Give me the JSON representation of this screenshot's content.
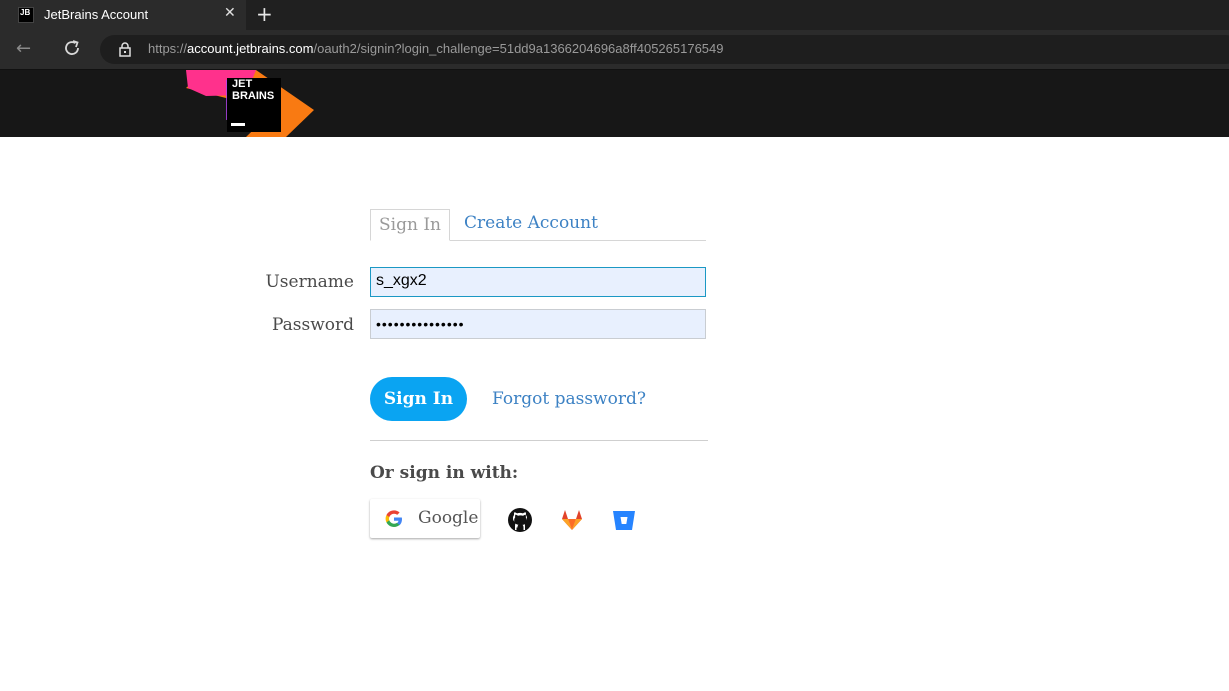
{
  "browser": {
    "tab_favicon_text": "JB",
    "tab_title": "JetBrains Account",
    "close_glyph": "✕",
    "new_tab_glyph": "+",
    "back_glyph": "←",
    "url_prefix": "https://",
    "url_host": "account.jetbrains.com",
    "url_path": "/oauth2/signin?login_challenge=51dd9a1366204696a8ff405265176549"
  },
  "header": {
    "logo_line1": "JET",
    "logo_line2": "BRAINS",
    "logo_colors": [
      "#f97a12",
      "#b345f1",
      "#ff318c",
      "#000000"
    ]
  },
  "form": {
    "tabs": {
      "signin_label": "Sign In",
      "create_label": "Create Account"
    },
    "username_label": "Username",
    "username_value": "s_xgx2",
    "password_label": "Password",
    "password_value": "•••••••••••••••",
    "signin_button": "Sign In",
    "forgot_link": "Forgot password?",
    "or_signin_with": "Or sign in with:",
    "google_label": "Google",
    "social_icons": [
      "github-icon",
      "gitlab-icon",
      "bitbucket-icon"
    ]
  },
  "colors": {
    "accent_button": "#0aa4f2",
    "link": "#3d82c4",
    "input_bg": "#e8f0fe",
    "header_bg": "#171717"
  }
}
